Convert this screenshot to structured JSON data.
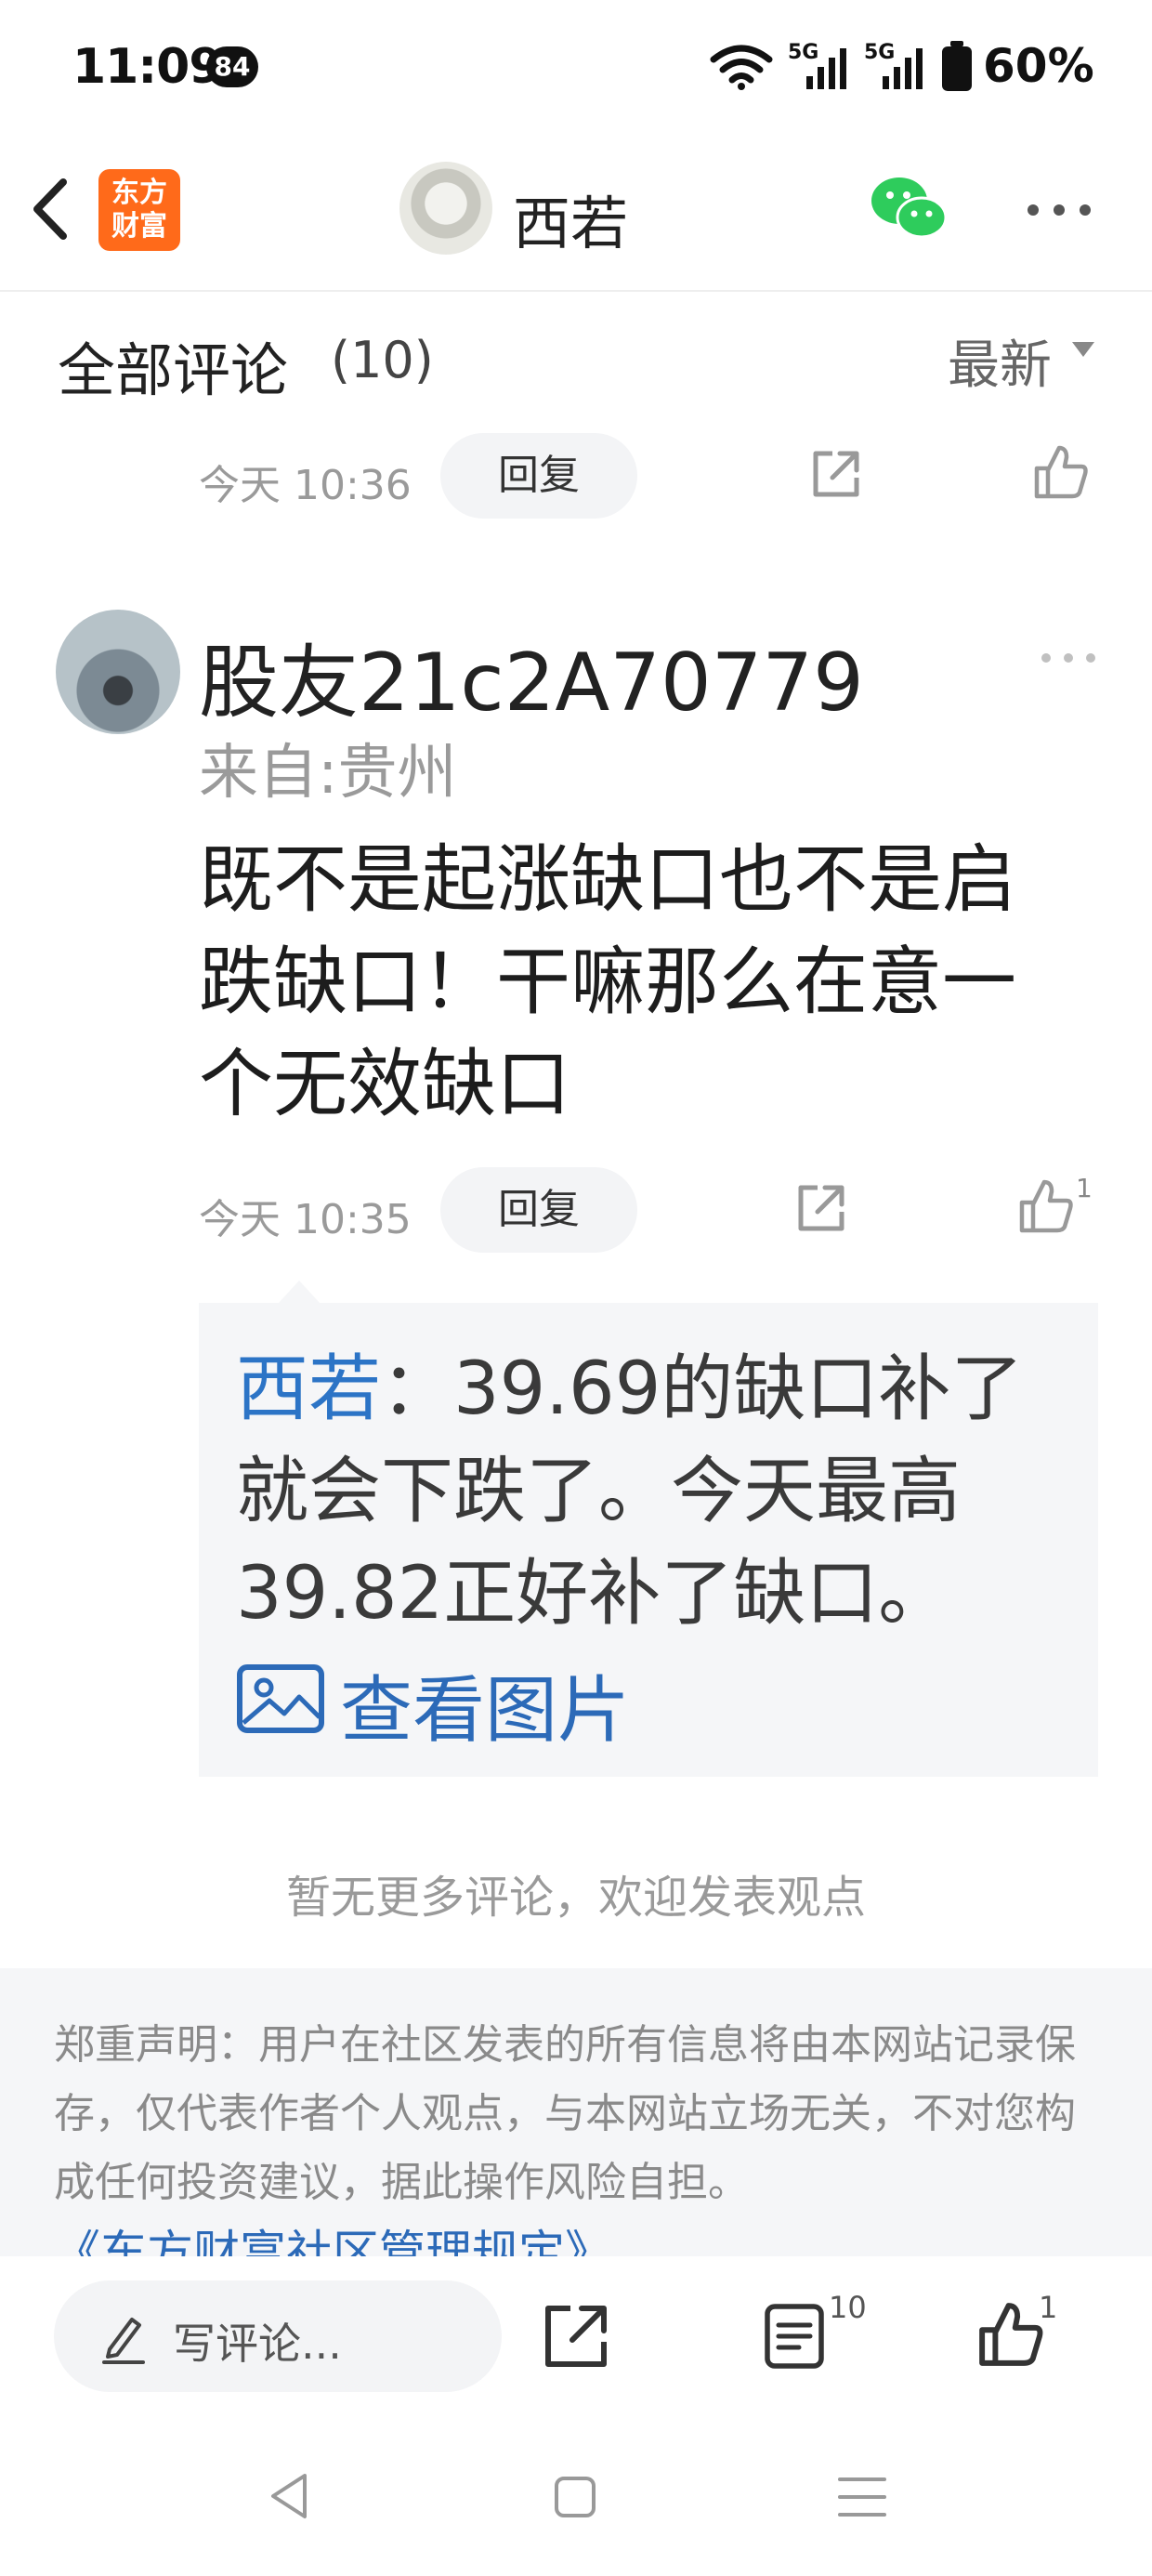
{
  "status_bar": {
    "time": "11:09",
    "notification_count": "84",
    "battery": "60%",
    "network_1": "5G",
    "network_2": "5G"
  },
  "header": {
    "brand_line1": "东方",
    "brand_line2": "财富",
    "author_name": "西若"
  },
  "comments_header": {
    "title": "全部评论",
    "count": "(10)",
    "sort": "最新"
  },
  "prev_comment": {
    "time": "今天 10:36",
    "reply": "回复"
  },
  "comment": {
    "username": "股友21c2A70779",
    "location": "来自:贵州",
    "text": "既不是起涨缺口也不是启跌缺口！干嘛那么在意一个无效缺口",
    "time": "今天 10:35",
    "reply": "回复",
    "likes": "1"
  },
  "reply": {
    "author": "西若",
    "text": "：39.69的缺口补了就会下跌了。今天最高39.82正好补了缺口。",
    "image_link": "查看图片"
  },
  "no_more": "暂无更多评论，欢迎发表观点",
  "disclaimer": {
    "text": "郑重声明：用户在社区发表的所有信息将由本网站记录保存，仅代表作者个人观点，与本网站立场无关，不对您构成任何投资建议，据此操作风险自担。",
    "link": "《东方财富社区管理规定》"
  },
  "bottom_bar": {
    "write_placeholder": "写评论...",
    "comment_count": "10",
    "like_count": "1"
  },
  "colors": {
    "brand": "#ff6a1a",
    "link": "#2c6ab8",
    "wechat": "#2ecc5c",
    "panel": "#f5f6f8"
  }
}
